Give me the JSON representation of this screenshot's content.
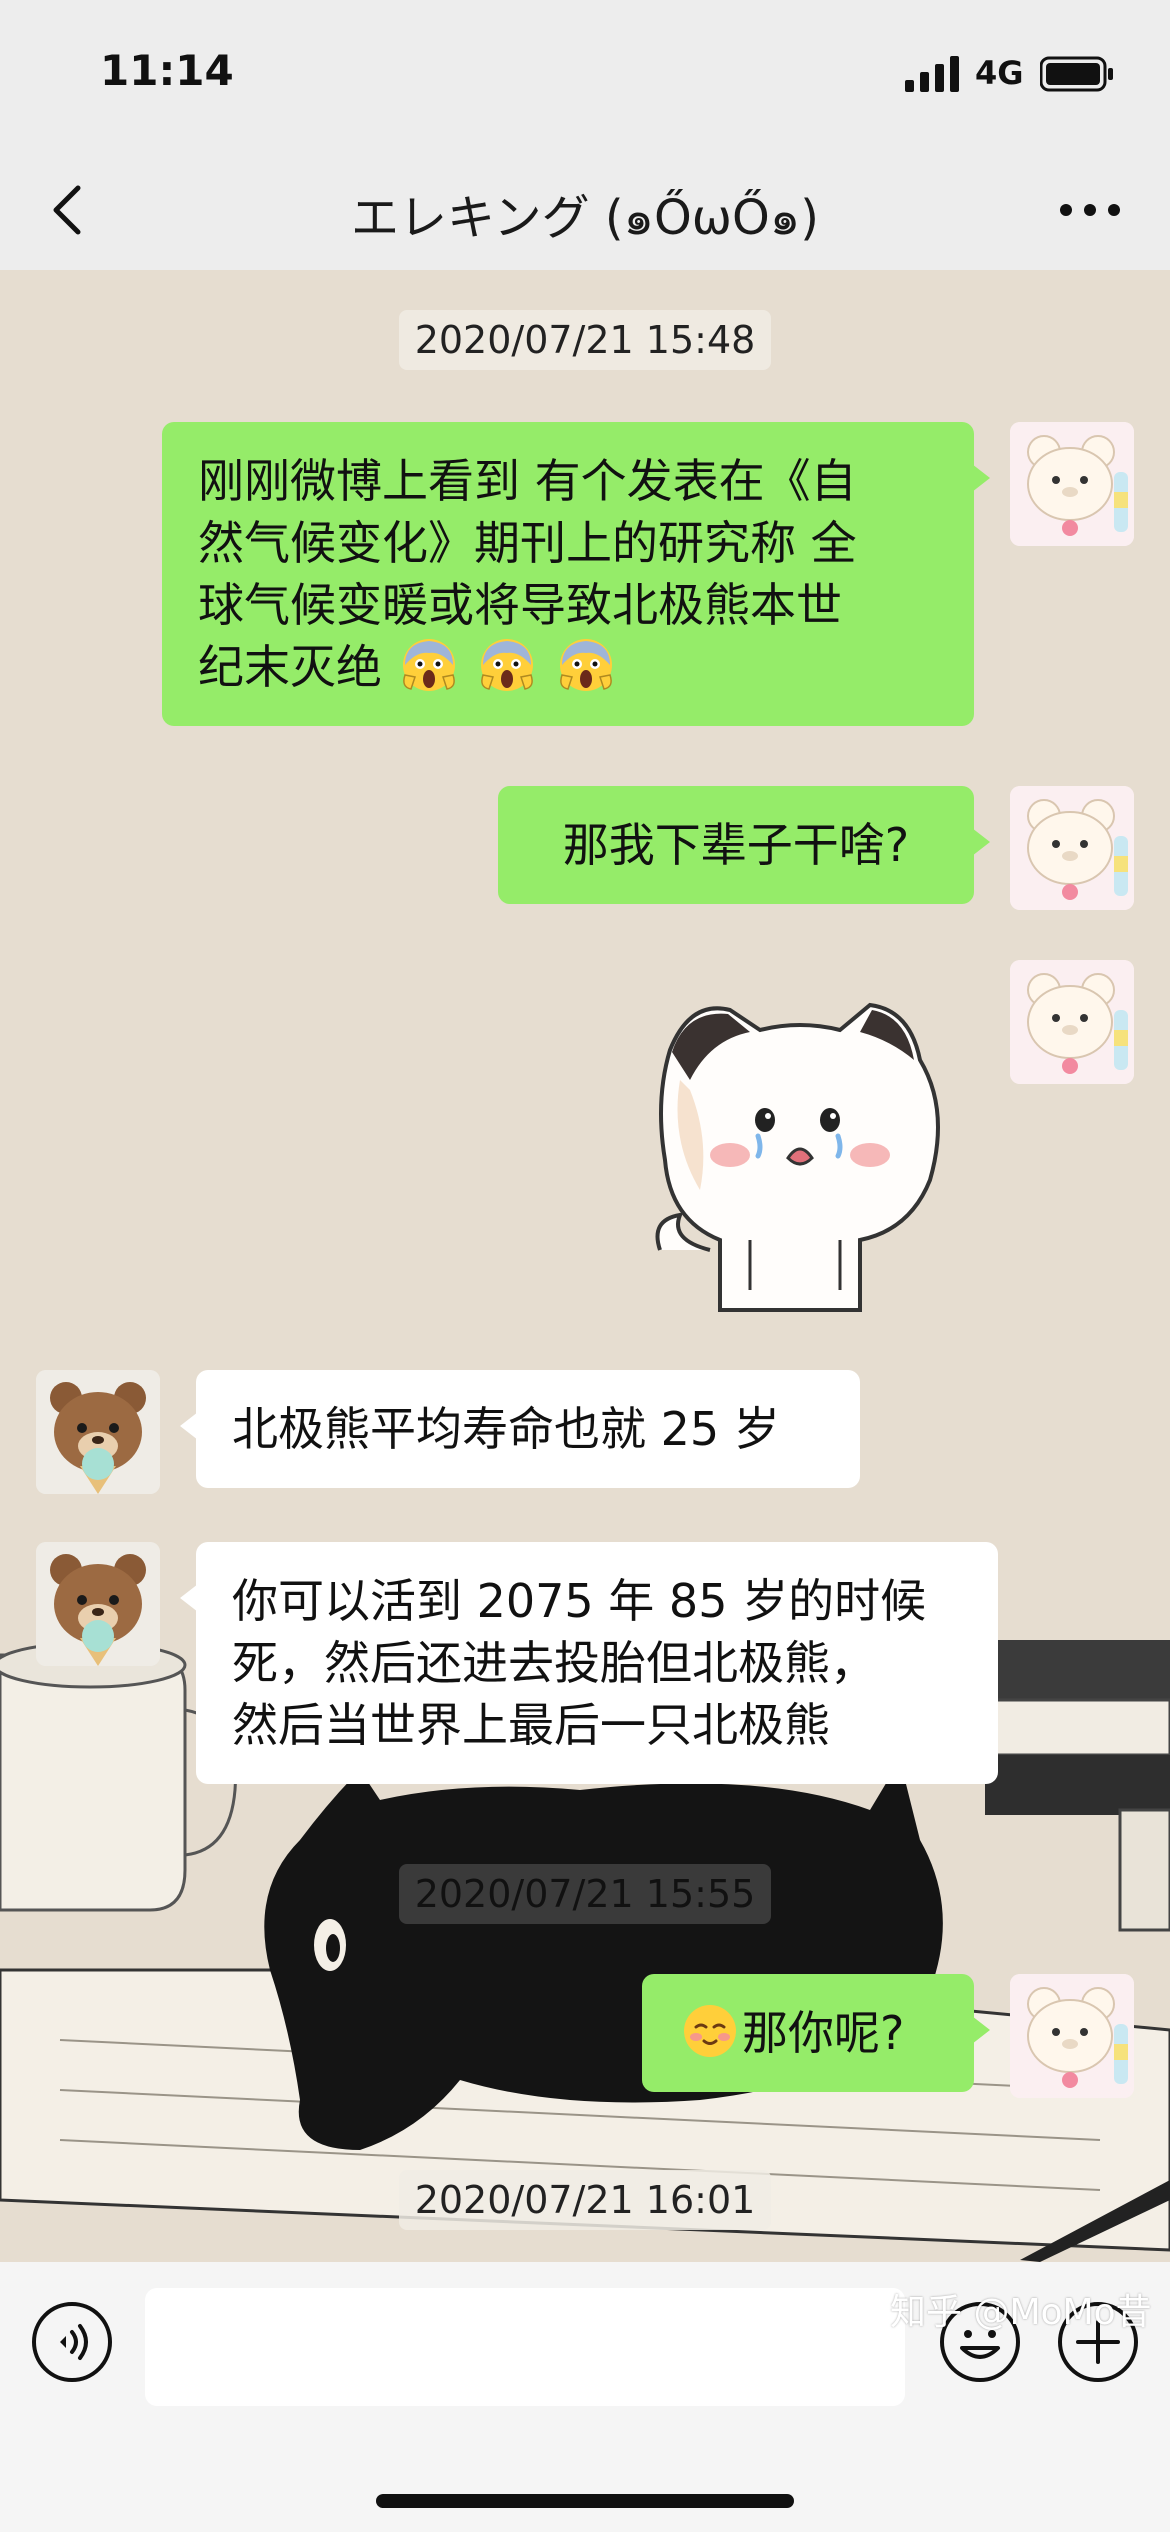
{
  "status_bar": {
    "time": "11:14",
    "network": "4G"
  },
  "nav": {
    "title": "エレキング (๑ŐωŐ๑)"
  },
  "chat": {
    "timestamps": [
      "2020/07/21 15:48",
      "2020/07/21 15:55",
      "2020/07/21 16:01"
    ],
    "messages": [
      {
        "side": "out",
        "lines": [
          "刚刚微博上看到 有个发表在《自",
          "然气候变化》期刊上的研究称 全",
          "球气候变暖或将导致北极熊本世",
          "纪末灭绝"
        ],
        "emoji": [
          "scream-emoji",
          "scream-emoji",
          "scream-emoji"
        ]
      },
      {
        "side": "out",
        "text": "那我下辈子干啥?"
      },
      {
        "side": "out",
        "sticker": "crying-cat-sticker"
      },
      {
        "side": "in",
        "text": "北极熊平均寿命也就 25 岁"
      },
      {
        "side": "in",
        "lines": [
          "你可以活到 2075 年 85 岁的时候",
          "死，然后还进去投胎但北极熊，",
          "然后当世界上最后一只北极熊"
        ]
      },
      {
        "side": "out",
        "emoji": "shy-smile-emoji",
        "text": "那你呢?"
      }
    ]
  },
  "input": {
    "placeholder": ""
  },
  "watermark": "知乎 @MoMo昔",
  "colors": {
    "outgoing_bubble": "#95ec69",
    "incoming_bubble": "#ffffff",
    "chat_bg": "#e6ddd0",
    "bar_bg": "#ededed"
  }
}
